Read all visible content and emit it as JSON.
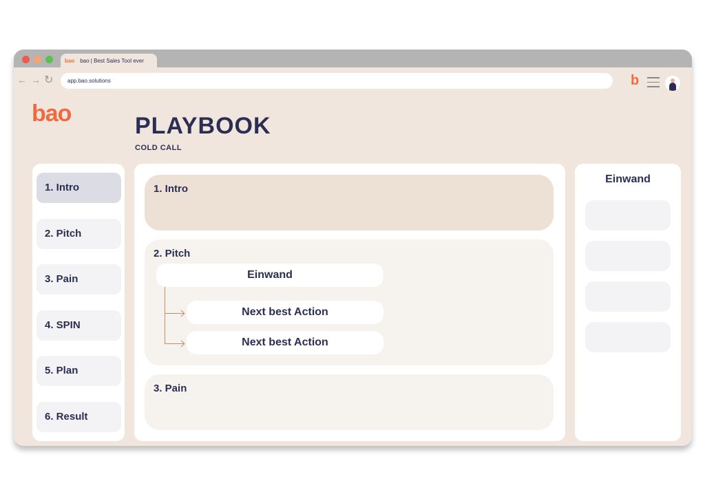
{
  "browser": {
    "tab_logo": "bao",
    "tab_title": "bao | Best Sales Tool ever",
    "url": "app.bao.solutions",
    "icon_logo": "b"
  },
  "app": {
    "logo": "bao",
    "title": "PLAYBOOK",
    "subtitle": "COLD CALL"
  },
  "sidebar": {
    "items": [
      {
        "label": "1. Intro",
        "active": true
      },
      {
        "label": "2. Pitch"
      },
      {
        "label": "3. Pain"
      },
      {
        "label": "4. SPIN"
      },
      {
        "label": "5. Plan"
      },
      {
        "label": "6. Result"
      }
    ]
  },
  "main": {
    "sections": [
      {
        "label": "1. Intro"
      },
      {
        "label": "2. Pitch",
        "objection": "Einwand",
        "actions": [
          "Next best Action",
          "Next best Action"
        ]
      },
      {
        "label": "3. Pain"
      }
    ]
  },
  "right_panel": {
    "title": "Einwand"
  },
  "colors": {
    "accent": "#f06a3f",
    "text": "#2b2d52",
    "background": "#f1e6de"
  }
}
